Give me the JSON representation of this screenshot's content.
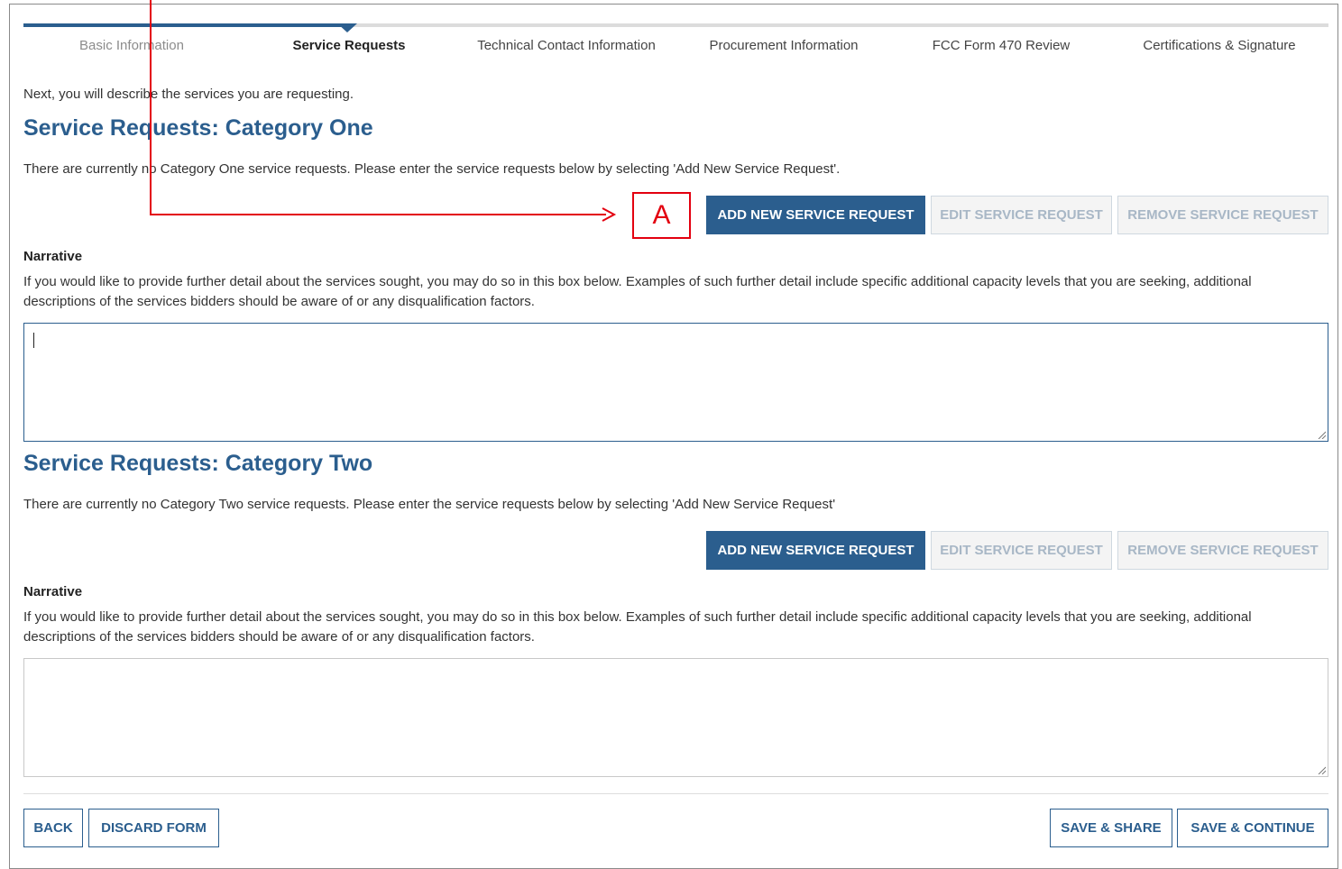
{
  "steps": [
    {
      "label": "Basic Information",
      "state": "done"
    },
    {
      "label": "Service Requests",
      "state": "active"
    },
    {
      "label": "Technical Contact Information",
      "state": "upcoming"
    },
    {
      "label": "Procurement Information",
      "state": "upcoming"
    },
    {
      "label": "FCC Form 470 Review",
      "state": "upcoming"
    },
    {
      "label": "Certifications & Signature",
      "state": "upcoming"
    }
  ],
  "intro": "Next, you will describe the services you are requesting.",
  "category_one": {
    "title": "Service Requests: Category One",
    "info": "There are currently no Category One service requests. Please enter the service requests below by selecting 'Add New Service Request'.",
    "add_label": "ADD NEW SERVICE REQUEST",
    "edit_label": "EDIT SERVICE REQUEST",
    "remove_label": "REMOVE SERVICE REQUEST",
    "narrative_label": "Narrative",
    "narrative_desc": "If you would like to provide further detail about the services sought, you may do so in this box below.  Examples of such further detail include specific additional capacity levels that you are seeking, additional descriptions of the services bidders should be aware of or any disqualification factors.",
    "narrative_value": ""
  },
  "category_two": {
    "title": "Service Requests: Category Two",
    "info": "There are currently no Category Two service requests. Please enter the service requests below by selecting 'Add New Service Request'",
    "add_label": "ADD NEW SERVICE REQUEST",
    "edit_label": "EDIT SERVICE REQUEST",
    "remove_label": "REMOVE SERVICE REQUEST",
    "narrative_label": "Narrative",
    "narrative_desc": "If you would like to provide further detail about the services sought, you may do so in this box below.  Examples of such further detail include specific additional capacity levels that you are seeking, additional descriptions of the services bidders should be aware of or any disqualification factors.",
    "narrative_value": ""
  },
  "footer": {
    "back_label": "BACK",
    "discard_label": "DISCARD FORM",
    "save_share_label": "SAVE & SHARE",
    "save_continue_label": "SAVE & CONTINUE"
  },
  "annotation": {
    "label": "A",
    "color": "#e3000f"
  },
  "colors": {
    "primary": "#2b5e8e",
    "disabled_text": "#a8b7c6"
  }
}
